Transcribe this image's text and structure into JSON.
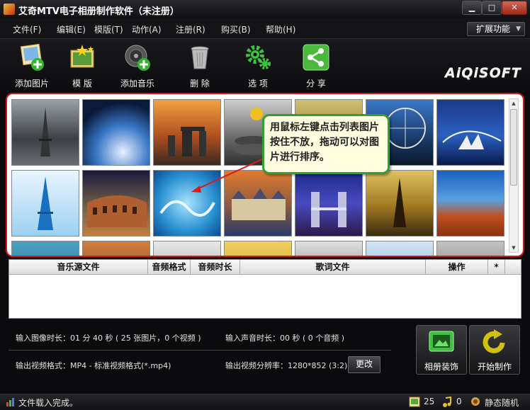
{
  "window": {
    "title": "艾奇MTV电子相册制作软件（未注册）"
  },
  "menu": {
    "items": [
      "文件(F)",
      "编辑(E)",
      "模版(T)",
      "动作(A)",
      "注册(R)",
      "购买(B)",
      "帮助(H)"
    ],
    "ext_label": "扩展功能"
  },
  "toolbar": {
    "items": [
      {
        "label": "添加图片",
        "icon": "add-photo-icon"
      },
      {
        "label": "模 版",
        "icon": "template-icon"
      },
      {
        "label": "添加音乐",
        "icon": "add-music-icon"
      },
      {
        "label": "删 除",
        "icon": "trash-icon"
      },
      {
        "label": "选 项",
        "icon": "gear-icon"
      },
      {
        "label": "分 享",
        "icon": "share-icon"
      }
    ],
    "logo": "AiQiSOFT"
  },
  "photos": {
    "callout": "用鼠标左键点击列表图片按住不放，拖动可以对图片进行排序。"
  },
  "music_table": {
    "columns": [
      "音乐源文件",
      "音频格式",
      "音频时长",
      "歌词文件",
      "操作",
      "*"
    ]
  },
  "info": {
    "image_duration": "输入图像时长：01 分 40 秒 ( 25 张图片，0 个视频 )",
    "audio_duration": "输入声音时长：00 秒 ( 0 个音频 )",
    "video_format": "输出视频格式：MP4 - 标准视频格式(*.mp4)",
    "resolution": "输出视频分辨率：1280*852 (3:2)",
    "change_label": "更改",
    "decorate_label": "相册装饰",
    "start_label": "开始制作"
  },
  "status": {
    "message": "文件载入完成。",
    "image_count": "25",
    "audio_count": "0",
    "mode": "静态随机"
  },
  "colors": {
    "highlight_border": "#d4161c",
    "callout_border": "#30a030",
    "accent_green": "#3cc23c"
  }
}
